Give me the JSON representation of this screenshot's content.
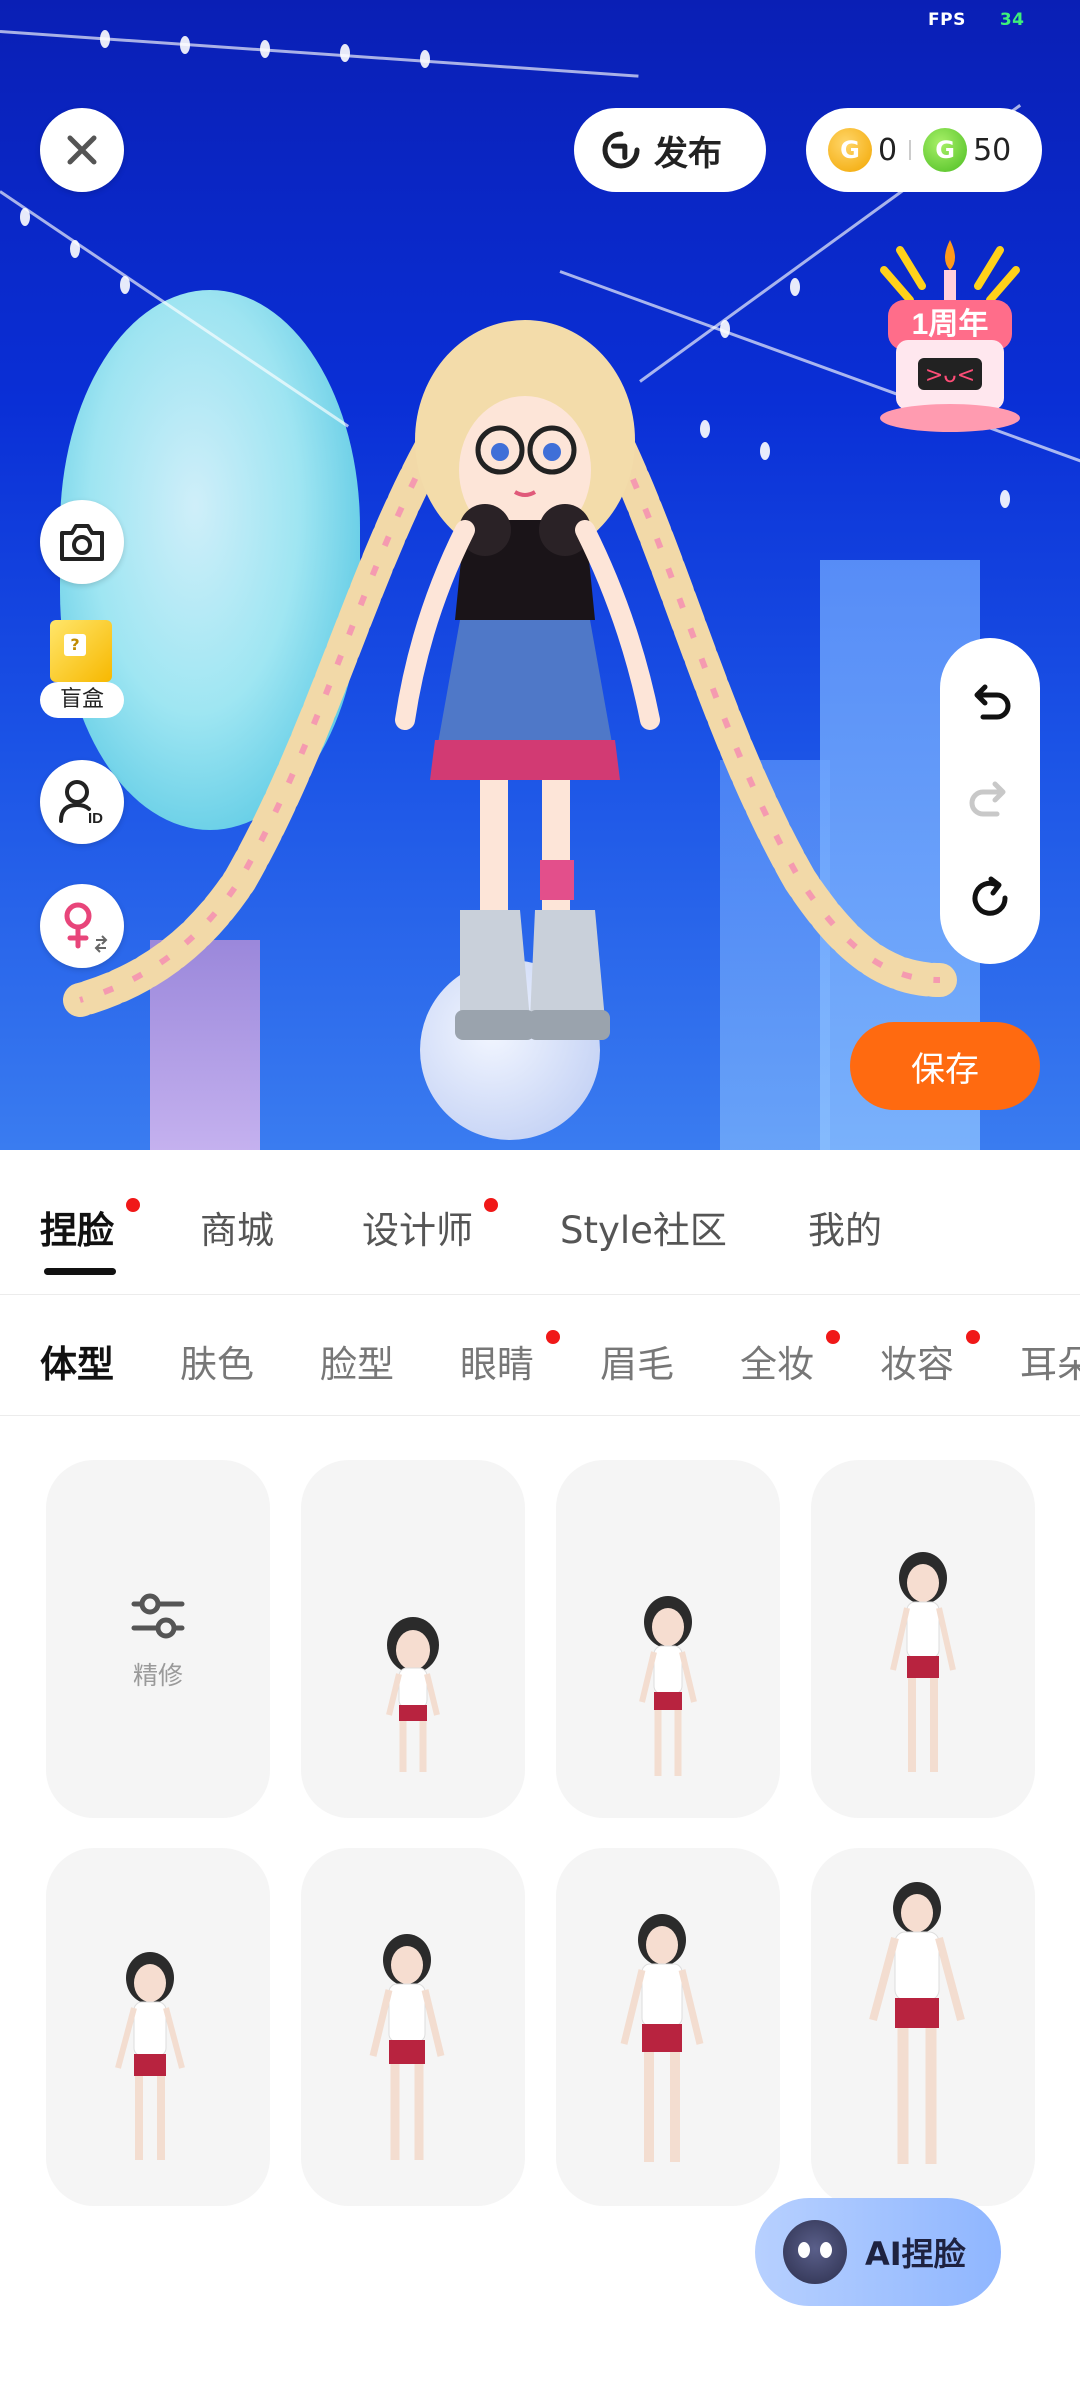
{
  "fps": {
    "label": "FPS",
    "value": "34"
  },
  "topbar": {
    "publish_label": "发布",
    "gold_coins": "0",
    "green_coins": "50",
    "anniversary_badge": "1周年"
  },
  "sidebar": {
    "blindbox_label": "盲盒"
  },
  "save_label": "保存",
  "main_tabs": [
    {
      "label": "捏脸",
      "active": true,
      "dot": true
    },
    {
      "label": "商城",
      "active": false,
      "dot": false
    },
    {
      "label": "设计师",
      "active": false,
      "dot": true
    },
    {
      "label": "Style社区",
      "active": false,
      "dot": false
    },
    {
      "label": "我的",
      "active": false,
      "dot": false
    }
  ],
  "sub_tabs": [
    {
      "label": "体型",
      "active": true,
      "dot": false
    },
    {
      "label": "肤色",
      "active": false,
      "dot": false
    },
    {
      "label": "脸型",
      "active": false,
      "dot": false
    },
    {
      "label": "眼睛",
      "active": false,
      "dot": true
    },
    {
      "label": "眉毛",
      "active": false,
      "dot": false
    },
    {
      "label": "全妆",
      "active": false,
      "dot": true
    },
    {
      "label": "妆容",
      "active": false,
      "dot": true
    },
    {
      "label": "耳朵",
      "active": false,
      "dot": false
    }
  ],
  "fine_tune_label": "精修",
  "ai_button_label": "AI捏脸",
  "colors": {
    "accent": "#ff6a10",
    "dot": "#f01818",
    "stage_bg": "#0a2fd6"
  }
}
